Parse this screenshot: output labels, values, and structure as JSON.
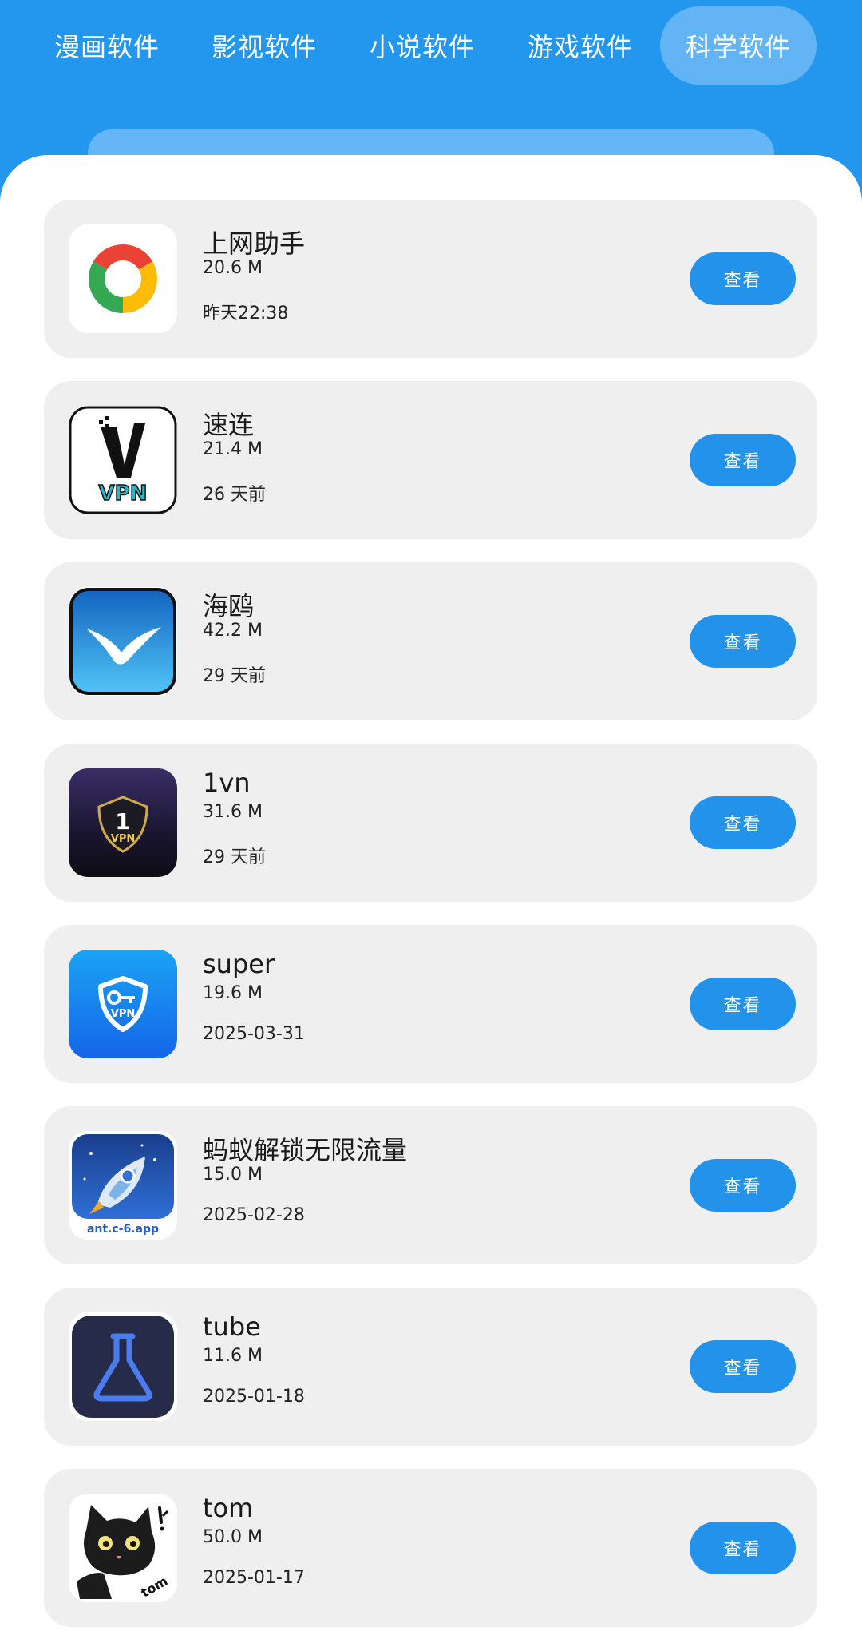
{
  "tabs": [
    {
      "label": "漫画软件",
      "active": false
    },
    {
      "label": "影视软件",
      "active": false
    },
    {
      "label": "小说软件",
      "active": false
    },
    {
      "label": "游戏软件",
      "active": false
    },
    {
      "label": "科学软件",
      "active": true
    }
  ],
  "colors": {
    "header_bg": "#2396ee",
    "active_tab_bg": "#62b4f5",
    "card_bg": "#efefef",
    "button_bg": "#2392ea"
  },
  "apps": [
    {
      "name": "上网助手",
      "size": "20.6 M",
      "date": "昨天22:38",
      "button": "查看",
      "icon": "chrome-like-icon"
    },
    {
      "name": "速连",
      "size": "21.4 M",
      "date": "26 天前",
      "button": "查看",
      "icon": "v-vpn-icon"
    },
    {
      "name": "海鸥",
      "size": "42.2 M",
      "date": "29 天前",
      "button": "查看",
      "icon": "seagull-icon"
    },
    {
      "name": "1vn",
      "size": "31.6 M",
      "date": "29 天前",
      "button": "查看",
      "icon": "shield-1-vpn-icon"
    },
    {
      "name": "super",
      "size": "19.6 M",
      "date": "2025-03-31",
      "button": "查看",
      "icon": "key-shield-vpn-icon"
    },
    {
      "name": "蚂蚁解锁无限流量",
      "size": "15.0 M",
      "date": "2025-02-28",
      "button": "查看",
      "icon": "ant-rocket-icon"
    },
    {
      "name": "tube",
      "size": "11.6 M",
      "date": "2025-01-18",
      "button": "查看",
      "icon": "flask-icon"
    },
    {
      "name": "tom",
      "size": "50.0 M",
      "date": "2025-01-17",
      "button": "查看",
      "icon": "black-cat-icon"
    }
  ],
  "icon_texts": {
    "v_vpn": "VPN",
    "shield_1": "1",
    "shield_vpn": "VPN",
    "key_vpn": "VPN",
    "ant_app": "ant.c-6.app",
    "cat_tom": "tom"
  }
}
